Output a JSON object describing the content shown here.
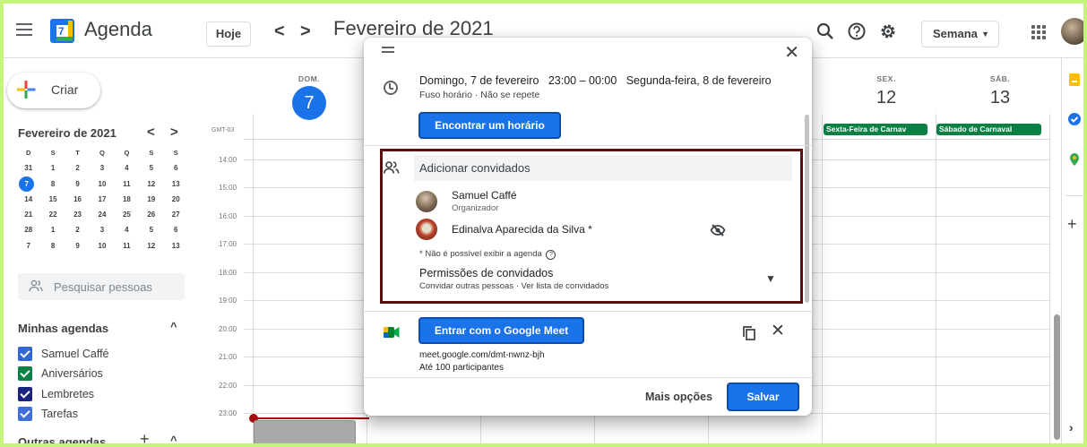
{
  "header": {
    "menu_icon": "hamburger-menu-icon",
    "logo_day": "7",
    "app_title": "Agenda",
    "today_button": "Hoje",
    "prev_glyph": "<",
    "next_glyph": ">",
    "period_title": "Fevereiro de 2021",
    "view_select": "Semana",
    "icons": [
      "search-icon",
      "help-icon",
      "settings-icon",
      "apps-grid-icon",
      "account-avatar"
    ]
  },
  "sidebar": {
    "create_label": "Criar",
    "mini_calendar": {
      "title": "Fevereiro de 2021",
      "weekday_headers": [
        "D",
        "S",
        "T",
        "Q",
        "Q",
        "S",
        "S"
      ],
      "weeks": [
        [
          "31",
          "1",
          "2",
          "3",
          "4",
          "5",
          "6"
        ],
        [
          "7",
          "8",
          "9",
          "10",
          "11",
          "12",
          "13"
        ],
        [
          "14",
          "15",
          "16",
          "17",
          "18",
          "19",
          "20"
        ],
        [
          "21",
          "22",
          "23",
          "24",
          "25",
          "26",
          "27"
        ],
        [
          "28",
          "1",
          "2",
          "3",
          "4",
          "5",
          "6"
        ],
        [
          "7",
          "8",
          "9",
          "10",
          "11",
          "12",
          "13"
        ]
      ],
      "selected_day": "7"
    },
    "search_people_placeholder": "Pesquisar pessoas",
    "my_calendars_title": "Minhas agendas",
    "my_calendars": [
      {
        "label": "Samuel Caffé",
        "color": "#3367d6"
      },
      {
        "label": "Aniversários",
        "color": "#0b8043"
      },
      {
        "label": "Lembretes",
        "color": "#1a237e"
      },
      {
        "label": "Tarefas",
        "color": "#3f6fd8"
      }
    ],
    "other_calendars_title": "Outras agendas"
  },
  "week": {
    "timezone": "GMT-03",
    "days": [
      {
        "name": "DOM.",
        "date": "7",
        "today": true
      },
      {
        "name": "SEX.",
        "date": "12",
        "today": false
      },
      {
        "name": "SÁB.",
        "date": "13",
        "today": false
      }
    ],
    "all_day_events": [
      "Sexta-Feira de Carnav",
      "Sábado de Carnaval"
    ],
    "hours": [
      "14:00",
      "15:00",
      "16:00",
      "17:00",
      "18:00",
      "19:00",
      "20:00",
      "21:00",
      "22:00",
      "23:00"
    ]
  },
  "dialog": {
    "date_start": "Domingo, 7 de fevereiro",
    "time_range": "23:00  –  00:00",
    "date_end": "Segunda-feira, 8 de fevereiro",
    "sub_info": "Fuso horário · Não se repete",
    "find_time_button": "Encontrar um horário",
    "add_guests_placeholder": "Adicionar convidados",
    "guests": [
      {
        "name": "Samuel Caffé",
        "role": "Organizador"
      },
      {
        "name": "Edinalva Aparecida da Silva *",
        "role": ""
      }
    ],
    "no_agenda_note": "* Não é possível exibir a agenda",
    "permissions_title": "Permissões de convidados",
    "permissions_sub": "Convidar outras pessoas · Ver lista de convidados",
    "meet_button": "Entrar com o Google Meet",
    "meet_link": "meet.google.com/dmt-nwnz-bjh",
    "meet_limit": "Até 100 participantes",
    "more_options": "Mais opções",
    "save_button": "Salvar"
  },
  "colors": {
    "accent": "#1a73e8",
    "event_green": "#0b8043",
    "now_line": "#a50e0e",
    "highlight_border": "#5a0f0f",
    "page_border": "#c4f57a"
  }
}
